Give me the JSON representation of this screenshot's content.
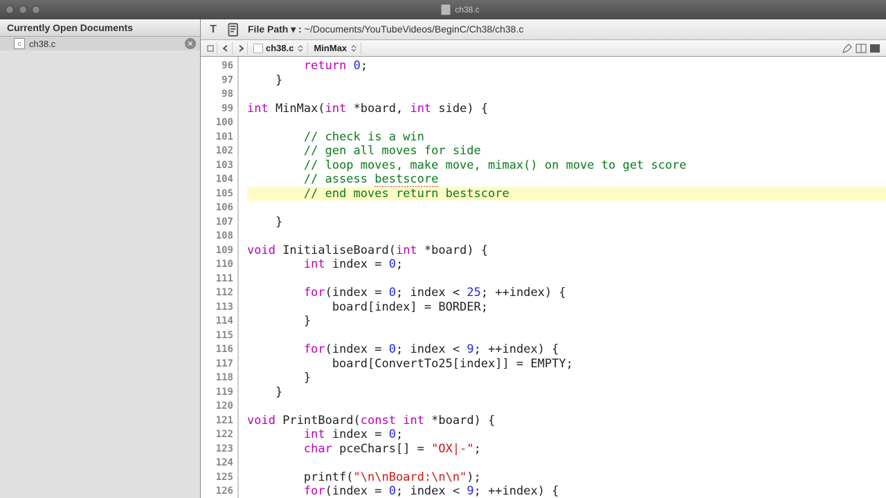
{
  "window": {
    "title": "ch38.c"
  },
  "sidebar": {
    "header": "Currently Open Documents",
    "items": [
      {
        "icon_label": "c",
        "name": "ch38.c"
      }
    ]
  },
  "pathbar": {
    "label_prefix": "File Path ▾ : ",
    "path": "~/Documents/YouTubeVideos/BeginC/Ch38/ch38.c"
  },
  "navbar": {
    "file": "ch38.c",
    "symbol": "MinMax"
  },
  "editor": {
    "first_line": 96,
    "highlighted_line": 105,
    "lines": [
      {
        "n": 96,
        "segs": [
          {
            "t": "        "
          },
          {
            "t": "return",
            "c": "kw"
          },
          {
            "t": " "
          },
          {
            "t": "0",
            "c": "nm"
          },
          {
            "t": ";"
          }
        ]
      },
      {
        "n": 97,
        "segs": [
          {
            "t": "    }"
          }
        ]
      },
      {
        "n": 98,
        "segs": [
          {
            "t": ""
          }
        ]
      },
      {
        "n": 99,
        "segs": [
          {
            "t": "int",
            "c": "ty"
          },
          {
            "t": " MinMax("
          },
          {
            "t": "int",
            "c": "ty"
          },
          {
            "t": " *board, "
          },
          {
            "t": "int",
            "c": "ty"
          },
          {
            "t": " side) {"
          }
        ]
      },
      {
        "n": 100,
        "segs": [
          {
            "t": ""
          }
        ]
      },
      {
        "n": 101,
        "segs": [
          {
            "t": "        "
          },
          {
            "t": "// check is a win",
            "c": "cm"
          }
        ]
      },
      {
        "n": 102,
        "segs": [
          {
            "t": "        "
          },
          {
            "t": "// gen all moves for side",
            "c": "cm"
          }
        ]
      },
      {
        "n": 103,
        "segs": [
          {
            "t": "        "
          },
          {
            "t": "// loop moves, make move, mimax() on move to get score",
            "c": "cm"
          }
        ]
      },
      {
        "n": 104,
        "segs": [
          {
            "t": "        "
          },
          {
            "t": "// assess ",
            "c": "cm"
          },
          {
            "t": "bestscore",
            "c": "cm spellerr"
          }
        ]
      },
      {
        "n": 105,
        "segs": [
          {
            "t": "        "
          },
          {
            "t": "// end moves return ",
            "c": "cm"
          },
          {
            "t": "bestscore",
            "c": "cm"
          }
        ]
      },
      {
        "n": 106,
        "segs": [
          {
            "t": ""
          }
        ]
      },
      {
        "n": 107,
        "segs": [
          {
            "t": "    }"
          }
        ]
      },
      {
        "n": 108,
        "segs": [
          {
            "t": ""
          }
        ]
      },
      {
        "n": 109,
        "segs": [
          {
            "t": "void",
            "c": "ty"
          },
          {
            "t": " InitialiseBoard("
          },
          {
            "t": "int",
            "c": "ty"
          },
          {
            "t": " *board) {"
          }
        ]
      },
      {
        "n": 110,
        "segs": [
          {
            "t": "        "
          },
          {
            "t": "int",
            "c": "ty"
          },
          {
            "t": " index = "
          },
          {
            "t": "0",
            "c": "nm"
          },
          {
            "t": ";"
          }
        ]
      },
      {
        "n": 111,
        "segs": [
          {
            "t": ""
          }
        ]
      },
      {
        "n": 112,
        "segs": [
          {
            "t": "        "
          },
          {
            "t": "for",
            "c": "kw"
          },
          {
            "t": "(index = "
          },
          {
            "t": "0",
            "c": "nm"
          },
          {
            "t": "; index < "
          },
          {
            "t": "25",
            "c": "nm"
          },
          {
            "t": "; ++index) {"
          }
        ]
      },
      {
        "n": 113,
        "segs": [
          {
            "t": "            board[index] = BORDER;"
          }
        ]
      },
      {
        "n": 114,
        "segs": [
          {
            "t": "        }"
          }
        ]
      },
      {
        "n": 115,
        "segs": [
          {
            "t": ""
          }
        ]
      },
      {
        "n": 116,
        "segs": [
          {
            "t": "        "
          },
          {
            "t": "for",
            "c": "kw"
          },
          {
            "t": "(index = "
          },
          {
            "t": "0",
            "c": "nm"
          },
          {
            "t": "; index < "
          },
          {
            "t": "9",
            "c": "nm"
          },
          {
            "t": "; ++index) {"
          }
        ]
      },
      {
        "n": 117,
        "segs": [
          {
            "t": "            board[ConvertTo25[index]] = EMPTY;"
          }
        ]
      },
      {
        "n": 118,
        "segs": [
          {
            "t": "        }"
          }
        ]
      },
      {
        "n": 119,
        "segs": [
          {
            "t": "    }"
          }
        ]
      },
      {
        "n": 120,
        "segs": [
          {
            "t": ""
          }
        ]
      },
      {
        "n": 121,
        "segs": [
          {
            "t": "void",
            "c": "ty"
          },
          {
            "t": " PrintBoard("
          },
          {
            "t": "const",
            "c": "ty"
          },
          {
            "t": " "
          },
          {
            "t": "int",
            "c": "ty"
          },
          {
            "t": " *board) {"
          }
        ]
      },
      {
        "n": 122,
        "segs": [
          {
            "t": "        "
          },
          {
            "t": "int",
            "c": "ty"
          },
          {
            "t": " index = "
          },
          {
            "t": "0",
            "c": "nm"
          },
          {
            "t": ";"
          }
        ]
      },
      {
        "n": 123,
        "segs": [
          {
            "t": "        "
          },
          {
            "t": "char",
            "c": "ty"
          },
          {
            "t": " pceChars[] = "
          },
          {
            "t": "\"OX|-\"",
            "c": "st"
          },
          {
            "t": ";"
          }
        ]
      },
      {
        "n": 124,
        "segs": [
          {
            "t": ""
          }
        ]
      },
      {
        "n": 125,
        "segs": [
          {
            "t": "        printf("
          },
          {
            "t": "\"\\n\\nBoard:\\n\\n\"",
            "c": "st"
          },
          {
            "t": ");"
          }
        ]
      },
      {
        "n": 126,
        "segs": [
          {
            "t": "        "
          },
          {
            "t": "for",
            "c": "kw"
          },
          {
            "t": "(index = "
          },
          {
            "t": "0",
            "c": "nm"
          },
          {
            "t": "; index < "
          },
          {
            "t": "9",
            "c": "nm"
          },
          {
            "t": "; ++index) {"
          }
        ]
      }
    ]
  }
}
